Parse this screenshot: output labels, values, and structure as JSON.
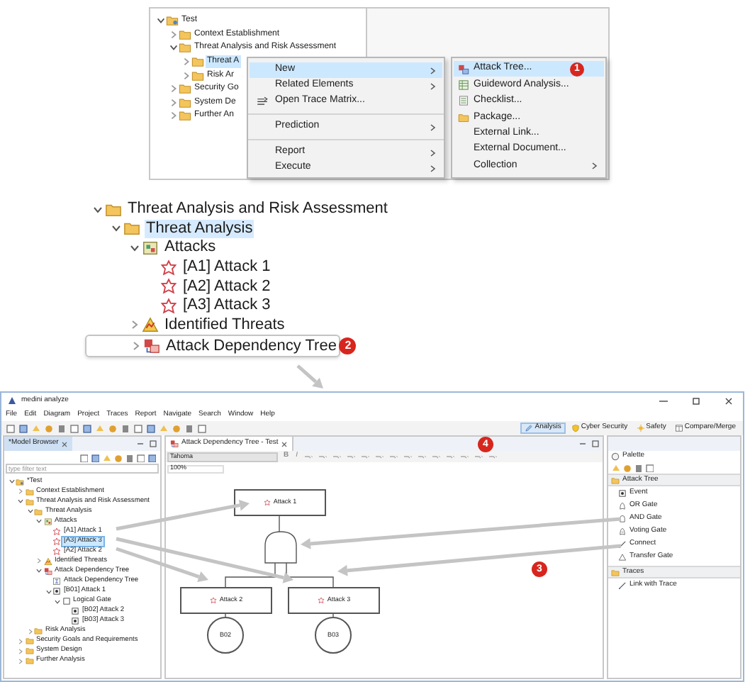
{
  "step_1": {
    "tree": [
      {
        "label": "Test",
        "kind": "project",
        "expanded": true,
        "selected": false,
        "children": [
          {
            "label": "Context Establishment",
            "kind": "folder",
            "expanded": false,
            "selected": false
          },
          {
            "label": "Threat Analysis and Risk Assessment",
            "kind": "folder",
            "expanded": true,
            "selected": false,
            "children": [
              {
                "label": "Threat A",
                "kind": "folder",
                "expanded": false,
                "selected": true
              },
              {
                "label": "Risk Ar",
                "kind": "folder",
                "expanded": false,
                "selected": false
              }
            ]
          },
          {
            "label": "Security Go",
            "kind": "folder",
            "expanded": false,
            "selected": false
          },
          {
            "label": "System De",
            "kind": "folder",
            "expanded": false,
            "selected": false
          },
          {
            "label": "Further An",
            "kind": "folder",
            "expanded": false,
            "selected": false
          }
        ]
      }
    ],
    "context_menu": {
      "groups": [
        [
          {
            "label": "New",
            "kind": "plain",
            "submenu": true,
            "selected": true
          },
          {
            "label": "Related Elements",
            "kind": "plain",
            "submenu": true,
            "selected": false
          },
          {
            "label": "Open Trace Matrix...",
            "kind": "trace-matrix",
            "submenu": false,
            "selected": false
          }
        ],
        [
          {
            "label": "Prediction",
            "kind": "plain",
            "submenu": true,
            "selected": false
          }
        ],
        [
          {
            "label": "Report",
            "kind": "plain",
            "submenu": true,
            "selected": false
          },
          {
            "label": "Execute",
            "kind": "plain",
            "submenu": true,
            "selected": false
          }
        ]
      ]
    },
    "submenu": {
      "items": [
        {
          "label": "Attack Tree...",
          "kind": "attack-tree",
          "submenu": false,
          "selected": true,
          "badge": "1"
        },
        {
          "label": "Guideword Analysis...",
          "kind": "guideword",
          "submenu": false,
          "selected": false
        },
        {
          "label": "Checklist...",
          "kind": "checklist",
          "submenu": false,
          "selected": false
        },
        {
          "label": "Package...",
          "kind": "folder",
          "submenu": false,
          "selected": false
        },
        {
          "label": "External Link...",
          "kind": "plain",
          "submenu": false,
          "selected": false
        },
        {
          "label": "External Document...",
          "kind": "plain",
          "submenu": false,
          "selected": false
        },
        {
          "label": "Collection",
          "kind": "plain",
          "submenu": true,
          "selected": false
        }
      ]
    }
  },
  "step_2": {
    "tree": [
      {
        "label": "Threat Analysis and Risk Assessment",
        "kind": "folder",
        "expanded": true,
        "selected": false,
        "children": [
          {
            "label": "Threat Analysis",
            "kind": "folder",
            "expanded": true,
            "selected": true,
            "children": [
              {
                "label": "Attacks",
                "kind": "package",
                "expanded": true,
                "selected": false,
                "children": [
                  {
                    "label": "[A1] Attack 1",
                    "kind": "attack",
                    "selected": false
                  },
                  {
                    "label": "[A2] Attack 2",
                    "kind": "attack",
                    "selected": false
                  },
                  {
                    "label": "[A3] Attack 3",
                    "kind": "attack",
                    "selected": false
                  }
                ]
              },
              {
                "label": "Identified Threats",
                "kind": "threats",
                "expanded": false,
                "selected": false
              },
              {
                "label": "Attack Dependency Tree",
                "kind": "dependency-tree",
                "expanded": false,
                "selected": false,
                "framed": true,
                "badge": "2"
              }
            ]
          }
        ]
      }
    ]
  },
  "step_3": {
    "window": {
      "title": "medini analyze"
    },
    "menu_bar": [
      "File",
      "Edit",
      "Diagram",
      "Project",
      "Traces",
      "Report",
      "Navigate",
      "Search",
      "Window",
      "Help"
    ],
    "perspectives": [
      {
        "label": "Analysis",
        "kind": "analysis",
        "selected": true
      },
      {
        "label": "Cyber Security",
        "kind": "security",
        "selected": false
      },
      {
        "label": "Safety",
        "kind": "safety",
        "selected": false
      },
      {
        "label": "Compare/Merge",
        "kind": "compare",
        "selected": false
      }
    ],
    "model_browser": {
      "tab": "*Model Browser",
      "filter": {
        "placeholder": "type filter text"
      },
      "tree": [
        {
          "label": "*Test",
          "kind": "project",
          "expanded": true,
          "selected": false,
          "children": [
            {
              "label": "Context Establishment",
              "kind": "folder",
              "expanded": false,
              "selected": false
            },
            {
              "label": "Threat Analysis and Risk Assessment",
              "kind": "folder",
              "expanded": true,
              "selected": false,
              "children": [
                {
                  "label": "Threat Analysis",
                  "kind": "folder",
                  "expanded": true,
                  "selected": false,
                  "children": [
                    {
                      "label": "Attacks",
                      "kind": "package",
                      "expanded": true,
                      "selected": false,
                      "children": [
                        {
                          "label": "[A1] Attack 1",
                          "kind": "attack",
                          "selected": false
                        },
                        {
                          "label": "[A3] Attack 3",
                          "kind": "attack",
                          "selected": true
                        },
                        {
                          "label": "[A2] Attack 2",
                          "kind": "attack",
                          "selected": false
                        }
                      ]
                    },
                    {
                      "label": "Identified Threats",
                      "kind": "threats",
                      "expanded": false,
                      "selected": false
                    },
                    {
                      "label": "Attack Dependency Tree",
                      "kind": "dependency-tree",
                      "expanded": true,
                      "selected": false,
                      "children": [
                        {
                          "label": "Attack Dependency Tree",
                          "kind": "diagram",
                          "selected": false
                        },
                        {
                          "label": "[B01] Attack 1",
                          "kind": "event",
                          "expanded": true,
                          "selected": false,
                          "children": [
                            {
                              "label": "Logical Gate",
                              "kind": "gate",
                              "expanded": true,
                              "selected": false,
                              "children": [
                                {
                                  "label": "[B02] Attack 2",
                                  "kind": "event",
                                  "selected": false
                                },
                                {
                                  "label": "[B03] Attack 3",
                                  "kind": "event",
                                  "selected": false
                                }
                              ]
                            }
                          ]
                        }
                      ]
                    }
                  ]
                },
                {
                  "label": "Risk Analysis",
                  "kind": "folder",
                  "expanded": false,
                  "selected": false
                }
              ]
            },
            {
              "label": "Security Goals and Requirements",
              "kind": "folder",
              "expanded": false,
              "selected": false
            },
            {
              "label": "System Design",
              "kind": "folder",
              "expanded": false,
              "selected": false
            },
            {
              "label": "Further Analysis",
              "kind": "folder",
              "expanded": false,
              "selected": false
            }
          ]
        }
      ]
    },
    "editor": {
      "tab": "Attack Dependency Tree - Test",
      "font": "Tahoma",
      "format_buttons": [
        "B",
        "I"
      ],
      "zoom": "100%",
      "toolbar_badge": "4",
      "badge": "3",
      "diagram": {
        "events": [
          {
            "label": "Attack 1"
          },
          {
            "label": "Attack 2"
          },
          {
            "label": "Attack 3"
          }
        ],
        "basic_events": [
          {
            "label": "B02"
          },
          {
            "label": "B03"
          }
        ]
      }
    },
    "palette": {
      "title": "Palette",
      "sections": [
        {
          "label": "Attack Tree",
          "tools": [
            {
              "label": "Event",
              "kind": "event"
            },
            {
              "label": "OR Gate",
              "kind": "or-gate"
            },
            {
              "label": "AND Gate",
              "kind": "and-gate"
            },
            {
              "label": "Voting Gate",
              "kind": "voting-gate"
            },
            {
              "label": "Connect",
              "kind": "connect"
            },
            {
              "label": "Transfer Gate",
              "kind": "transfer-gate"
            }
          ]
        },
        {
          "label": "Traces",
          "tools": [
            {
              "label": "Link with Trace",
              "kind": "connect"
            }
          ]
        }
      ]
    }
  }
}
